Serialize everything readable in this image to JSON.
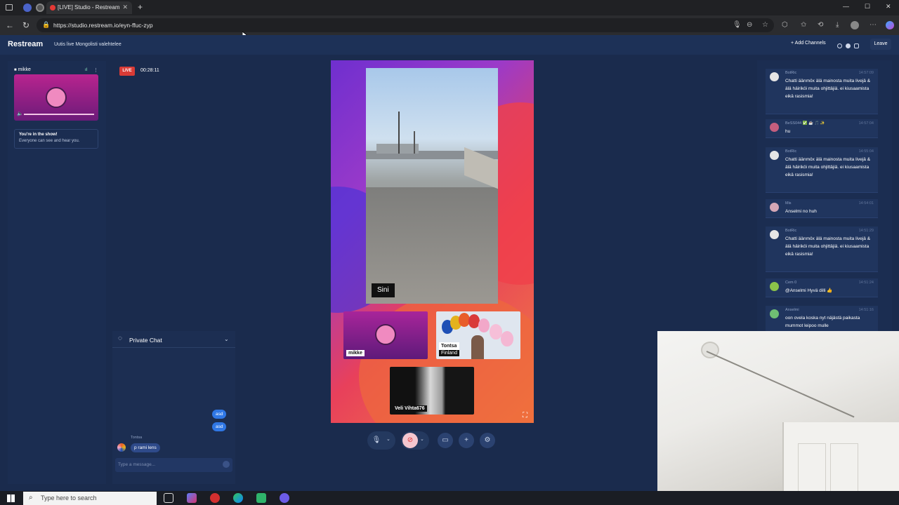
{
  "browser": {
    "tab_title": "[LIVE] Studio - Restream",
    "url": "https://studio.restream.io/eyn-ffuc-zyp",
    "tab_close": "✕",
    "new_tab": "+",
    "win_min": "—",
    "win_max": "☐",
    "win_close": "✕"
  },
  "header": {
    "logo": "Restream",
    "title": "Uutis live Mongolisti valehtelee",
    "add_channels": "+ Add Channels",
    "leave": "Leave"
  },
  "left_panel": {
    "cam_name": "mikke",
    "show_title": "You're in the show!",
    "show_sub": "Everyone can see and hear you."
  },
  "stage": {
    "live_badge": "LIVE",
    "timer": "00:28:11",
    "main_name": "Sini",
    "tiles": [
      {
        "name": "mikke",
        "sub": ""
      },
      {
        "name": "Tontsa",
        "sub": "Finland"
      },
      {
        "name": "Veli Vihta676",
        "sub": ""
      }
    ]
  },
  "private_chat": {
    "title": "Private Chat",
    "messages": [
      "asd",
      "asd"
    ],
    "incoming_name": "Tontsa",
    "incoming_text": "p rami lens",
    "input_placeholder": "Type a message..."
  },
  "chat": {
    "messages": [
      {
        "name": "BotRic",
        "time": "14:57:09",
        "text": "Chatti äänmöx älä mainosta muita livejä & älä häiriköi muita ohjittäjiä. ei kiusaamista eikä rasismia!",
        "avatar_color": "#e5e5e5"
      },
      {
        "name": "BeSS044 ✅ ☕ 🎵 ✨",
        "time": "14:57:04",
        "text": "hu",
        "avatar_color": "#c45e7e"
      },
      {
        "name": "BotRic",
        "time": "14:55:04",
        "text": "Chatti äänmöx älä mainosta muita livejä & älä häiriköi muita ohjittäjiä. ei kiusaamista eikä rasismia!",
        "avatar_color": "#e5e5e5"
      },
      {
        "name": "Mis",
        "time": "14:54:01",
        "text": "Anselmi no huh",
        "avatar_color": "#d4a7b6"
      },
      {
        "name": "BotRic",
        "time": "14:51:29",
        "text": "Chatti äänmöx älä mainosta muita livejä & älä häiriköi muita ohjittäjiä. ei kiusaamista eikä rasismia!",
        "avatar_color": "#e5e5e5"
      },
      {
        "name": "Cem 0",
        "time": "14:51:24",
        "text": "@Anselmi Hyvä dilli 👍",
        "avatar_color": "#8bc34a"
      },
      {
        "name": "Anselmi",
        "time": "14:51:16",
        "text": "oon ovela koska nyt näjästä paikasta mummot leipoo mulle",
        "avatar_color": "#6fbf73"
      }
    ]
  },
  "taskbar": {
    "search_placeholder": "Type here to search"
  }
}
